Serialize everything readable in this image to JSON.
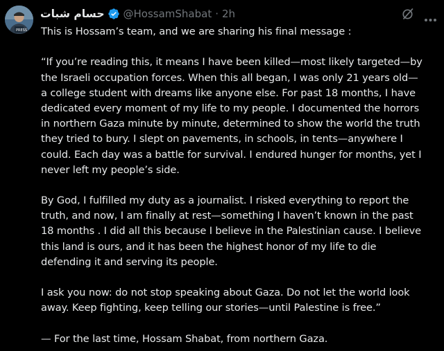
{
  "post": {
    "display_name": "حسام شبات",
    "handle": "@HossamShabat",
    "separator": "·",
    "time": "2h",
    "paragraphs": [
      [
        "This is Hossam’s team, and we are sharing his final message :"
      ],
      [
        "“If you’re reading this, it means I have been killed—most likely targeted—by",
        "the Israeli occupation forces. When this all began, I was only 21 years old—",
        "a college student with dreams like anyone else. For past 18 months, I have",
        "dedicated every moment of my life to my people. I documented the horrors",
        "in northern Gaza minute by minute, determined to show the world the truth",
        "they tried to bury. I slept on pavements, in schools, in tents—anywhere I",
        "could. Each day was a battle for survival. I endured hunger for months, yet I",
        "never left my people’s side."
      ],
      [
        "By God, I fulfilled my duty as a journalist. I risked everything to report the",
        "truth, and now, I am finally at rest—something I haven’t known in the past",
        "18 months . I did all this because I believe in the Palestinian cause. I believe",
        "this land is ours, and it has been the highest honor of my life to die",
        "defending it and serving its people."
      ],
      [
        "I ask you now: do not stop speaking about Gaza. Do not let the world look",
        "away. Keep fighting, keep telling our stories—until Palestine is free.”"
      ],
      [
        "— For the last time, Hossam Shabat, from northern Gaza."
      ]
    ]
  },
  "icons": {
    "verified": "verified-badge-icon",
    "grok": "grok-icon",
    "more": "more-options-icon"
  },
  "colors": {
    "background": "#000000",
    "text": "#e7e9ea",
    "secondary": "#71767b",
    "verified": "#1d9bf0"
  }
}
